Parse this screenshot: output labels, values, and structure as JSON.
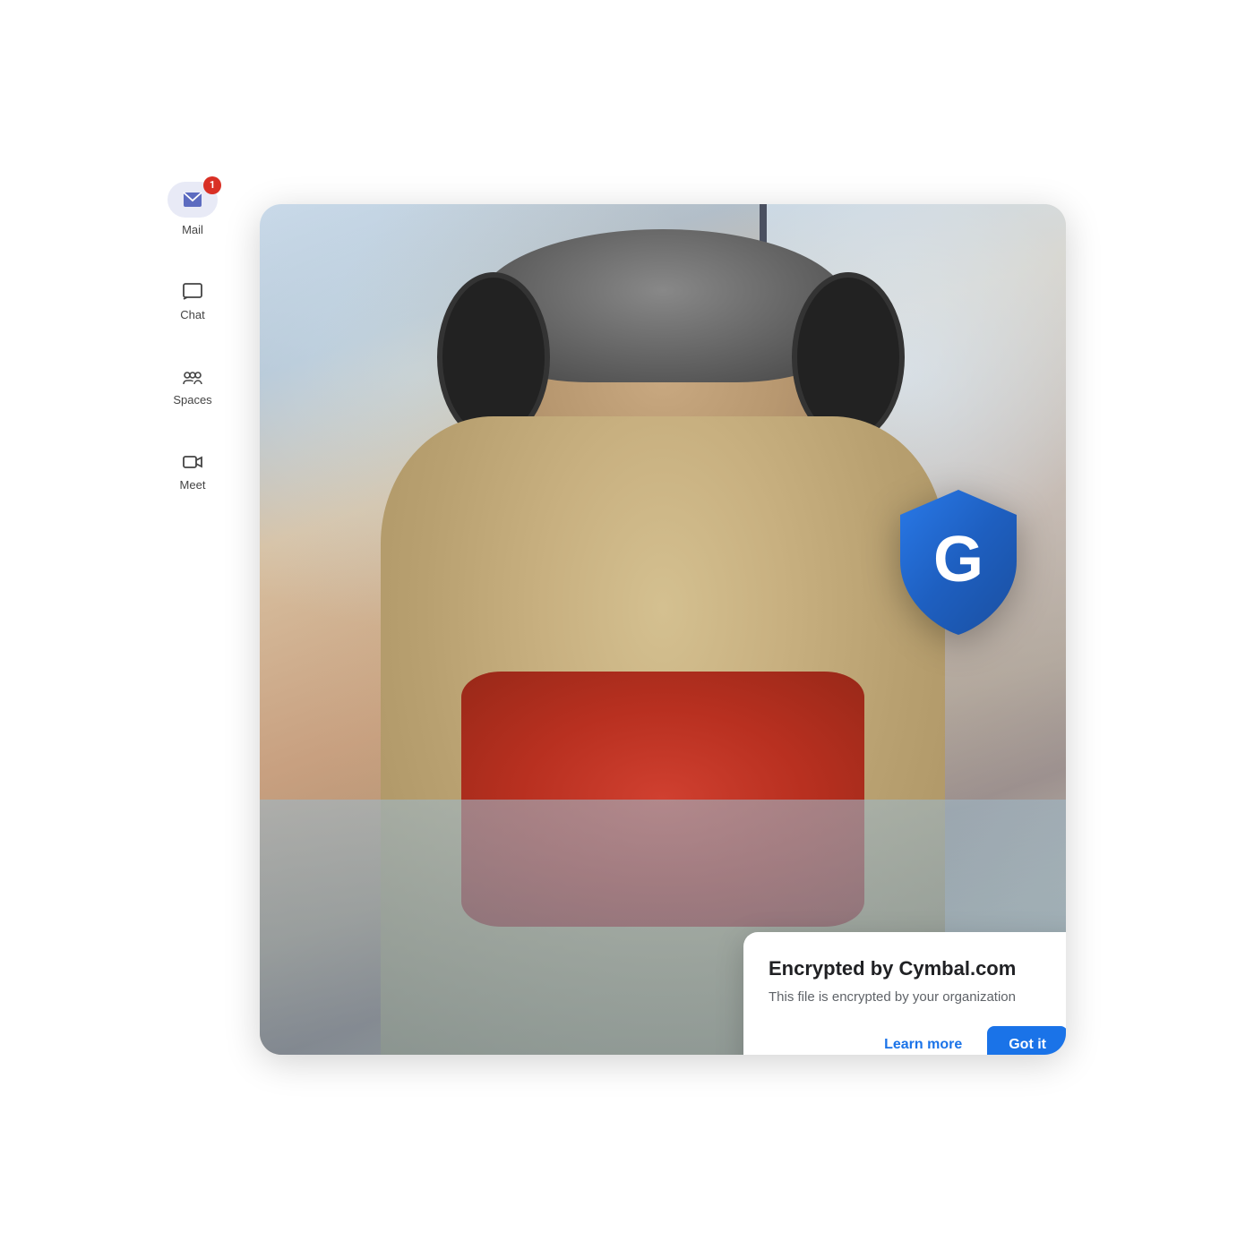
{
  "sidebar": {
    "items": [
      {
        "id": "mail",
        "label": "Mail",
        "badge": "1",
        "has_badge": true
      },
      {
        "id": "chat",
        "label": "Chat",
        "has_badge": false
      },
      {
        "id": "spaces",
        "label": "Spaces",
        "has_badge": false
      },
      {
        "id": "meet",
        "label": "Meet",
        "has_badge": false
      }
    ]
  },
  "encryption_card": {
    "title": "Encrypted by Cymbal.com",
    "subtitle": "This file is encrypted by your organization",
    "learn_more_label": "Learn more",
    "got_it_label": "Got it"
  },
  "shield": {
    "letter": "G"
  },
  "colors": {
    "primary_blue": "#1a73e8",
    "mail_bg": "#e8eaf6",
    "badge_red": "#d93025",
    "shield_dark": "#1a4fa0",
    "shield_mid": "#1e5fc0",
    "shield_light": "#2979e8"
  }
}
